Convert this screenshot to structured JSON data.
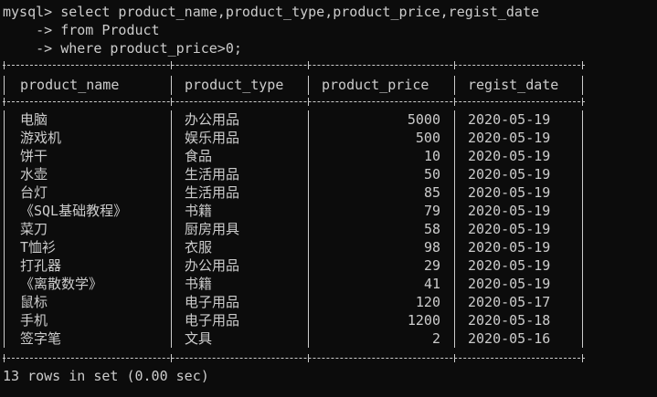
{
  "query": {
    "line1": "mysql> select product_name,product_type,product_price,regist_date",
    "line2": "    -> from Product",
    "line3": "    -> where product_price>0;"
  },
  "table": {
    "headers": [
      "product_name",
      "product_type",
      "product_price",
      "regist_date"
    ],
    "rows": [
      [
        "电脑",
        "办公用品",
        "5000",
        "2020-05-19"
      ],
      [
        "游戏机",
        "娱乐用品",
        "500",
        "2020-05-19"
      ],
      [
        "饼干",
        "食品",
        "10",
        "2020-05-19"
      ],
      [
        "水壶",
        "生活用品",
        "50",
        "2020-05-19"
      ],
      [
        "台灯",
        "生活用品",
        "85",
        "2020-05-19"
      ],
      [
        "《SQL基础教程》",
        "书籍",
        "79",
        "2020-05-19"
      ],
      [
        "菜刀",
        "厨房用具",
        "58",
        "2020-05-19"
      ],
      [
        "T恤衫",
        "衣服",
        "98",
        "2020-05-19"
      ],
      [
        "打孔器",
        "办公用品",
        "29",
        "2020-05-19"
      ],
      [
        "《离散数学》",
        "书籍",
        "41",
        "2020-05-19"
      ],
      [
        "鼠标",
        "电子用品",
        "120",
        "2020-05-17"
      ],
      [
        "手机",
        "电子用品",
        "1200",
        "2020-05-18"
      ],
      [
        "签字笔",
        "文具",
        "2",
        "2020-05-16"
      ]
    ]
  },
  "result": "13 rows in set (0.00 sec)",
  "colors": {
    "background": "#0c0c0c",
    "text": "#cccccc"
  }
}
